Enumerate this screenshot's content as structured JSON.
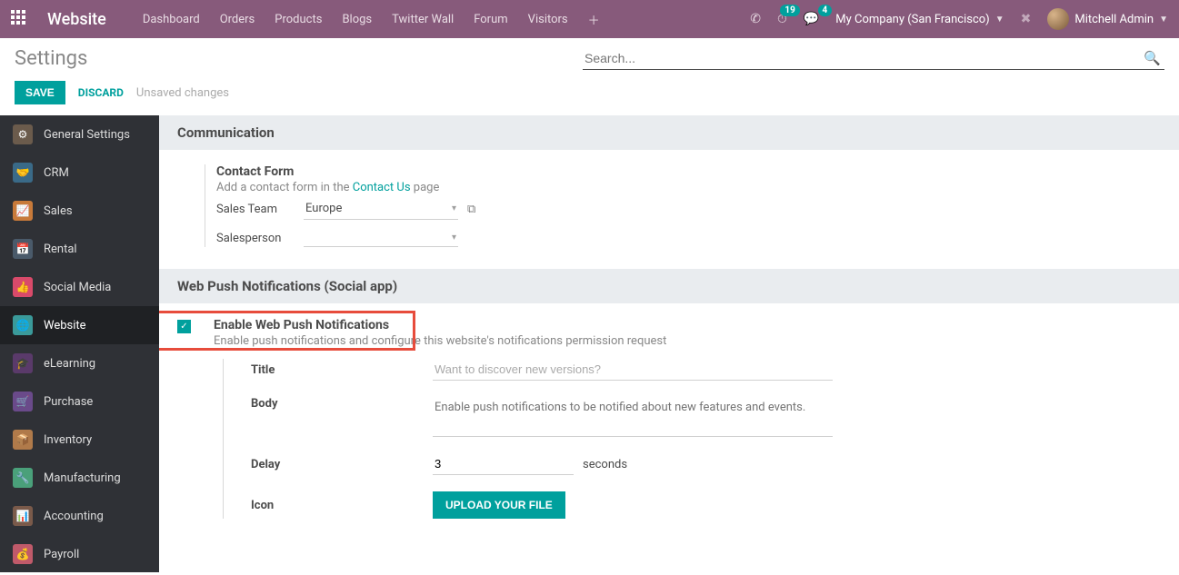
{
  "topbar": {
    "brand": "Website",
    "nav": [
      "Dashboard",
      "Orders",
      "Products",
      "Blogs",
      "Twitter Wall",
      "Forum",
      "Visitors"
    ],
    "activity_badge": "19",
    "msg_badge": "4",
    "company": "My Company (San Francisco)",
    "user": "Mitchell Admin"
  },
  "page": {
    "title": "Settings",
    "search_placeholder": "Search...",
    "save": "SAVE",
    "discard": "DISCARD",
    "unsaved": "Unsaved changes"
  },
  "sidebar": [
    {
      "label": "General Settings",
      "color": "#6b5b4c"
    },
    {
      "label": "CRM",
      "color": "#3a6a88"
    },
    {
      "label": "Sales",
      "color": "#c87a3a"
    },
    {
      "label": "Rental",
      "color": "#4a5a6a"
    },
    {
      "label": "Social Media",
      "color": "#d94a6a"
    },
    {
      "label": "Website",
      "color": "#3a9a9a",
      "active": true
    },
    {
      "label": "eLearning",
      "color": "#5a3a6a"
    },
    {
      "label": "Purchase",
      "color": "#6a4a8a"
    },
    {
      "label": "Inventory",
      "color": "#b07a4a"
    },
    {
      "label": "Manufacturing",
      "color": "#4aa07a"
    },
    {
      "label": "Accounting",
      "color": "#7a5a4a"
    },
    {
      "label": "Payroll",
      "color": "#c05a6a"
    }
  ],
  "sections": {
    "communication": {
      "title": "Communication",
      "contact_form": {
        "title": "Contact Form",
        "desc_pre": "Add a contact form in the ",
        "desc_link": "Contact Us",
        "desc_post": " page",
        "sales_team_label": "Sales Team",
        "sales_team_value": "Europe",
        "salesperson_label": "Salesperson",
        "salesperson_value": ""
      }
    },
    "webpush": {
      "title": "Web Push Notifications (Social app)",
      "enable_title": "Enable Web Push Notifications",
      "enable_desc": "Enable push notifications and configure this website's notifications permission request",
      "fields": {
        "title_label": "Title",
        "title_placeholder": "Want to discover new versions?",
        "body_label": "Body",
        "body_placeholder": "Enable push notifications to be notified about new features and events.",
        "delay_label": "Delay",
        "delay_value": "3",
        "delay_unit": "seconds",
        "icon_label": "Icon",
        "upload_btn": "UPLOAD YOUR FILE"
      }
    }
  }
}
